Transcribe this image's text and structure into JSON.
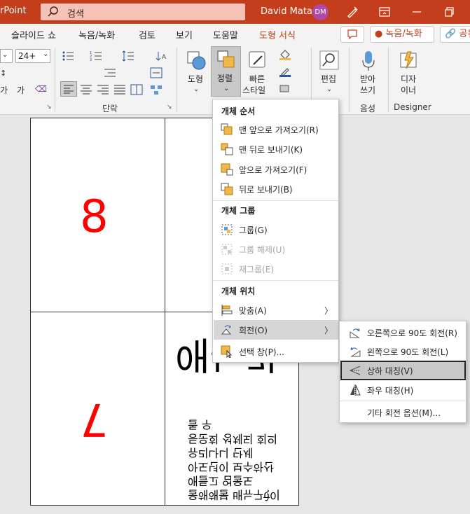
{
  "window": {
    "app_name": "rPoint",
    "search_text": "검색",
    "user_name": "David Mata",
    "avatar_initials": "DM"
  },
  "tabs": [
    {
      "label": "슬라이드 쇼"
    },
    {
      "label": "녹음/녹화"
    },
    {
      "label": "검토"
    },
    {
      "label": "보기"
    },
    {
      "label": "도움말"
    },
    {
      "label": "도형 서식"
    }
  ],
  "tab_buttons": {
    "record": "● 녹음/녹화",
    "share": "🔗 공유"
  },
  "ribbon": {
    "font_size": "24+",
    "group_paragraph": "단락",
    "group_voice": "음성",
    "group_designer": "Designer",
    "shape": "도형",
    "arrange": "정렬",
    "quick_style_1": "빠른",
    "quick_style_2": "스타일",
    "edit": "편집",
    "dictate_1": "받아",
    "dictate_2": "쓰기",
    "designer_1": "디자",
    "designer_2": "이너"
  },
  "slide": {
    "num_top": "8",
    "num_bottom": "7",
    "flipped_title": "애논가",
    "flipped_lines": [
      "울해해불 배뉴구ऐ이",
      "애들고 엄울도",
      "아도년이 보수하산",
      "유리나니 단세",
      "등운회 성체되 회의",
      "돌 우"
    ]
  },
  "menu": {
    "section_order": "개체 순서",
    "bring_front": "맨 앞으로 가져오기(R)",
    "send_back": "맨 뒤로 보내기(K)",
    "bring_forward": "앞으로 가져오기(F)",
    "send_backward": "뒤로 보내기(B)",
    "section_group": "개체 그룹",
    "group": "그룹(G)",
    "ungroup": "그룹 해제(U)",
    "regroup": "재그룹(E)",
    "section_position": "개체 위치",
    "align": "맞춤(A)",
    "rotate": "회전(O)",
    "selection_pane": "선택 창(P)..."
  },
  "submenu": {
    "rotate_right": "오른쪽으로 90도 회전(R)",
    "rotate_left": "왼쪽으로 90도 회전(L)",
    "flip_vertical": "상하 대칭(V)",
    "flip_horizontal": "좌우 대칭(H)",
    "more_options": "기타 회전 옵션(M)..."
  },
  "colors": {
    "titlebar": "#c43e1c",
    "accent": "#c43e1c",
    "number": "#ff0000"
  }
}
